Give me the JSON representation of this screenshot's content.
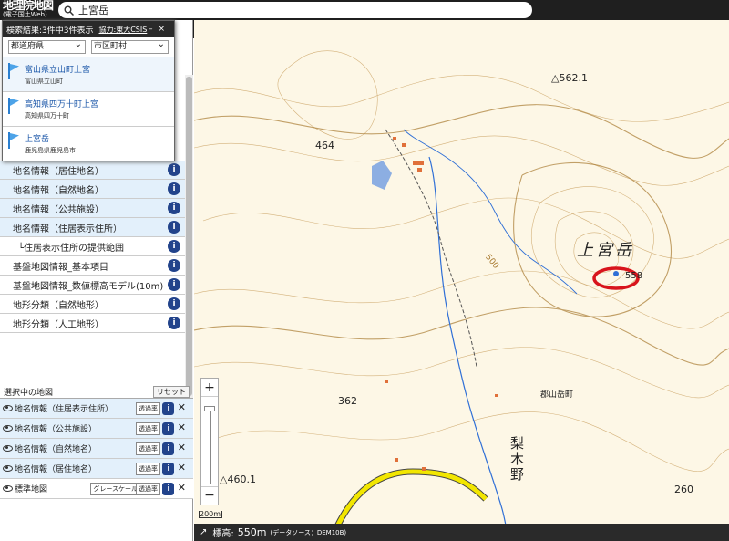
{
  "header": {
    "logo_title": "地理院地図",
    "logo_sub": "(電子国土Web)",
    "search_value": "上宮岳"
  },
  "popup": {
    "title": "検索結果:3件中3件表示",
    "link": "協力:東大CSIS",
    "pref_select": "都道府県",
    "city_select": "市区町村",
    "results": [
      {
        "name": "富山県立山町上宮",
        "sub": "富山県立山町"
      },
      {
        "name": "高知県四万十町上宮",
        "sub": "高知県四万十町"
      },
      {
        "name": "上宮岳",
        "sub": "鹿児島県鹿児島市"
      }
    ]
  },
  "layer_list": [
    {
      "label": "地名情報（居住地名）",
      "highlight": true
    },
    {
      "label": "地名情報（自然地名）",
      "highlight": true
    },
    {
      "label": "地名情報（公共施設）",
      "highlight": true
    },
    {
      "label": "地名情報（住居表示住所）",
      "highlight": true
    },
    {
      "label": "└住居表示住所の提供範囲",
      "highlight": false
    },
    {
      "label": "基盤地図情報_基本項目",
      "highlight": false
    },
    {
      "label": "基盤地図情報_数値標高モデル(10m)",
      "highlight": false
    },
    {
      "label": "地形分類（自然地形）",
      "highlight": false
    },
    {
      "label": "地形分類（人工地形）",
      "highlight": false
    }
  ],
  "selected": {
    "title": "選択中の地図",
    "reset": "リセット",
    "transparency": "透過率",
    "grayscale": "グレースケール",
    "items": [
      {
        "label": "地名情報（住居表示住所）"
      },
      {
        "label": "地名情報（公共施設）"
      },
      {
        "label": "地名情報（自然地名）"
      },
      {
        "label": "地名情報（居住地名）"
      },
      {
        "label": "標準地図"
      }
    ]
  },
  "map": {
    "peak_name": "上宮岳",
    "peak_elev": "558",
    "elevations": [
      "△562.1",
      "464",
      "362",
      "△460.1",
      "260"
    ],
    "place": "梨木野",
    "town": "郡山岳町",
    "contour": "500",
    "scale": "200m",
    "elevation_label": "標高:",
    "elevation_value": "550m",
    "elevation_source": "(データソース：DEM10B)"
  },
  "colors": {
    "header": "#1f1f1f",
    "info": "#22438b",
    "link": "#1a56a8",
    "highlight": "#e3f0fb",
    "road": "#f2e600",
    "river": "#2f6fd6",
    "circle": "#d8141c"
  }
}
